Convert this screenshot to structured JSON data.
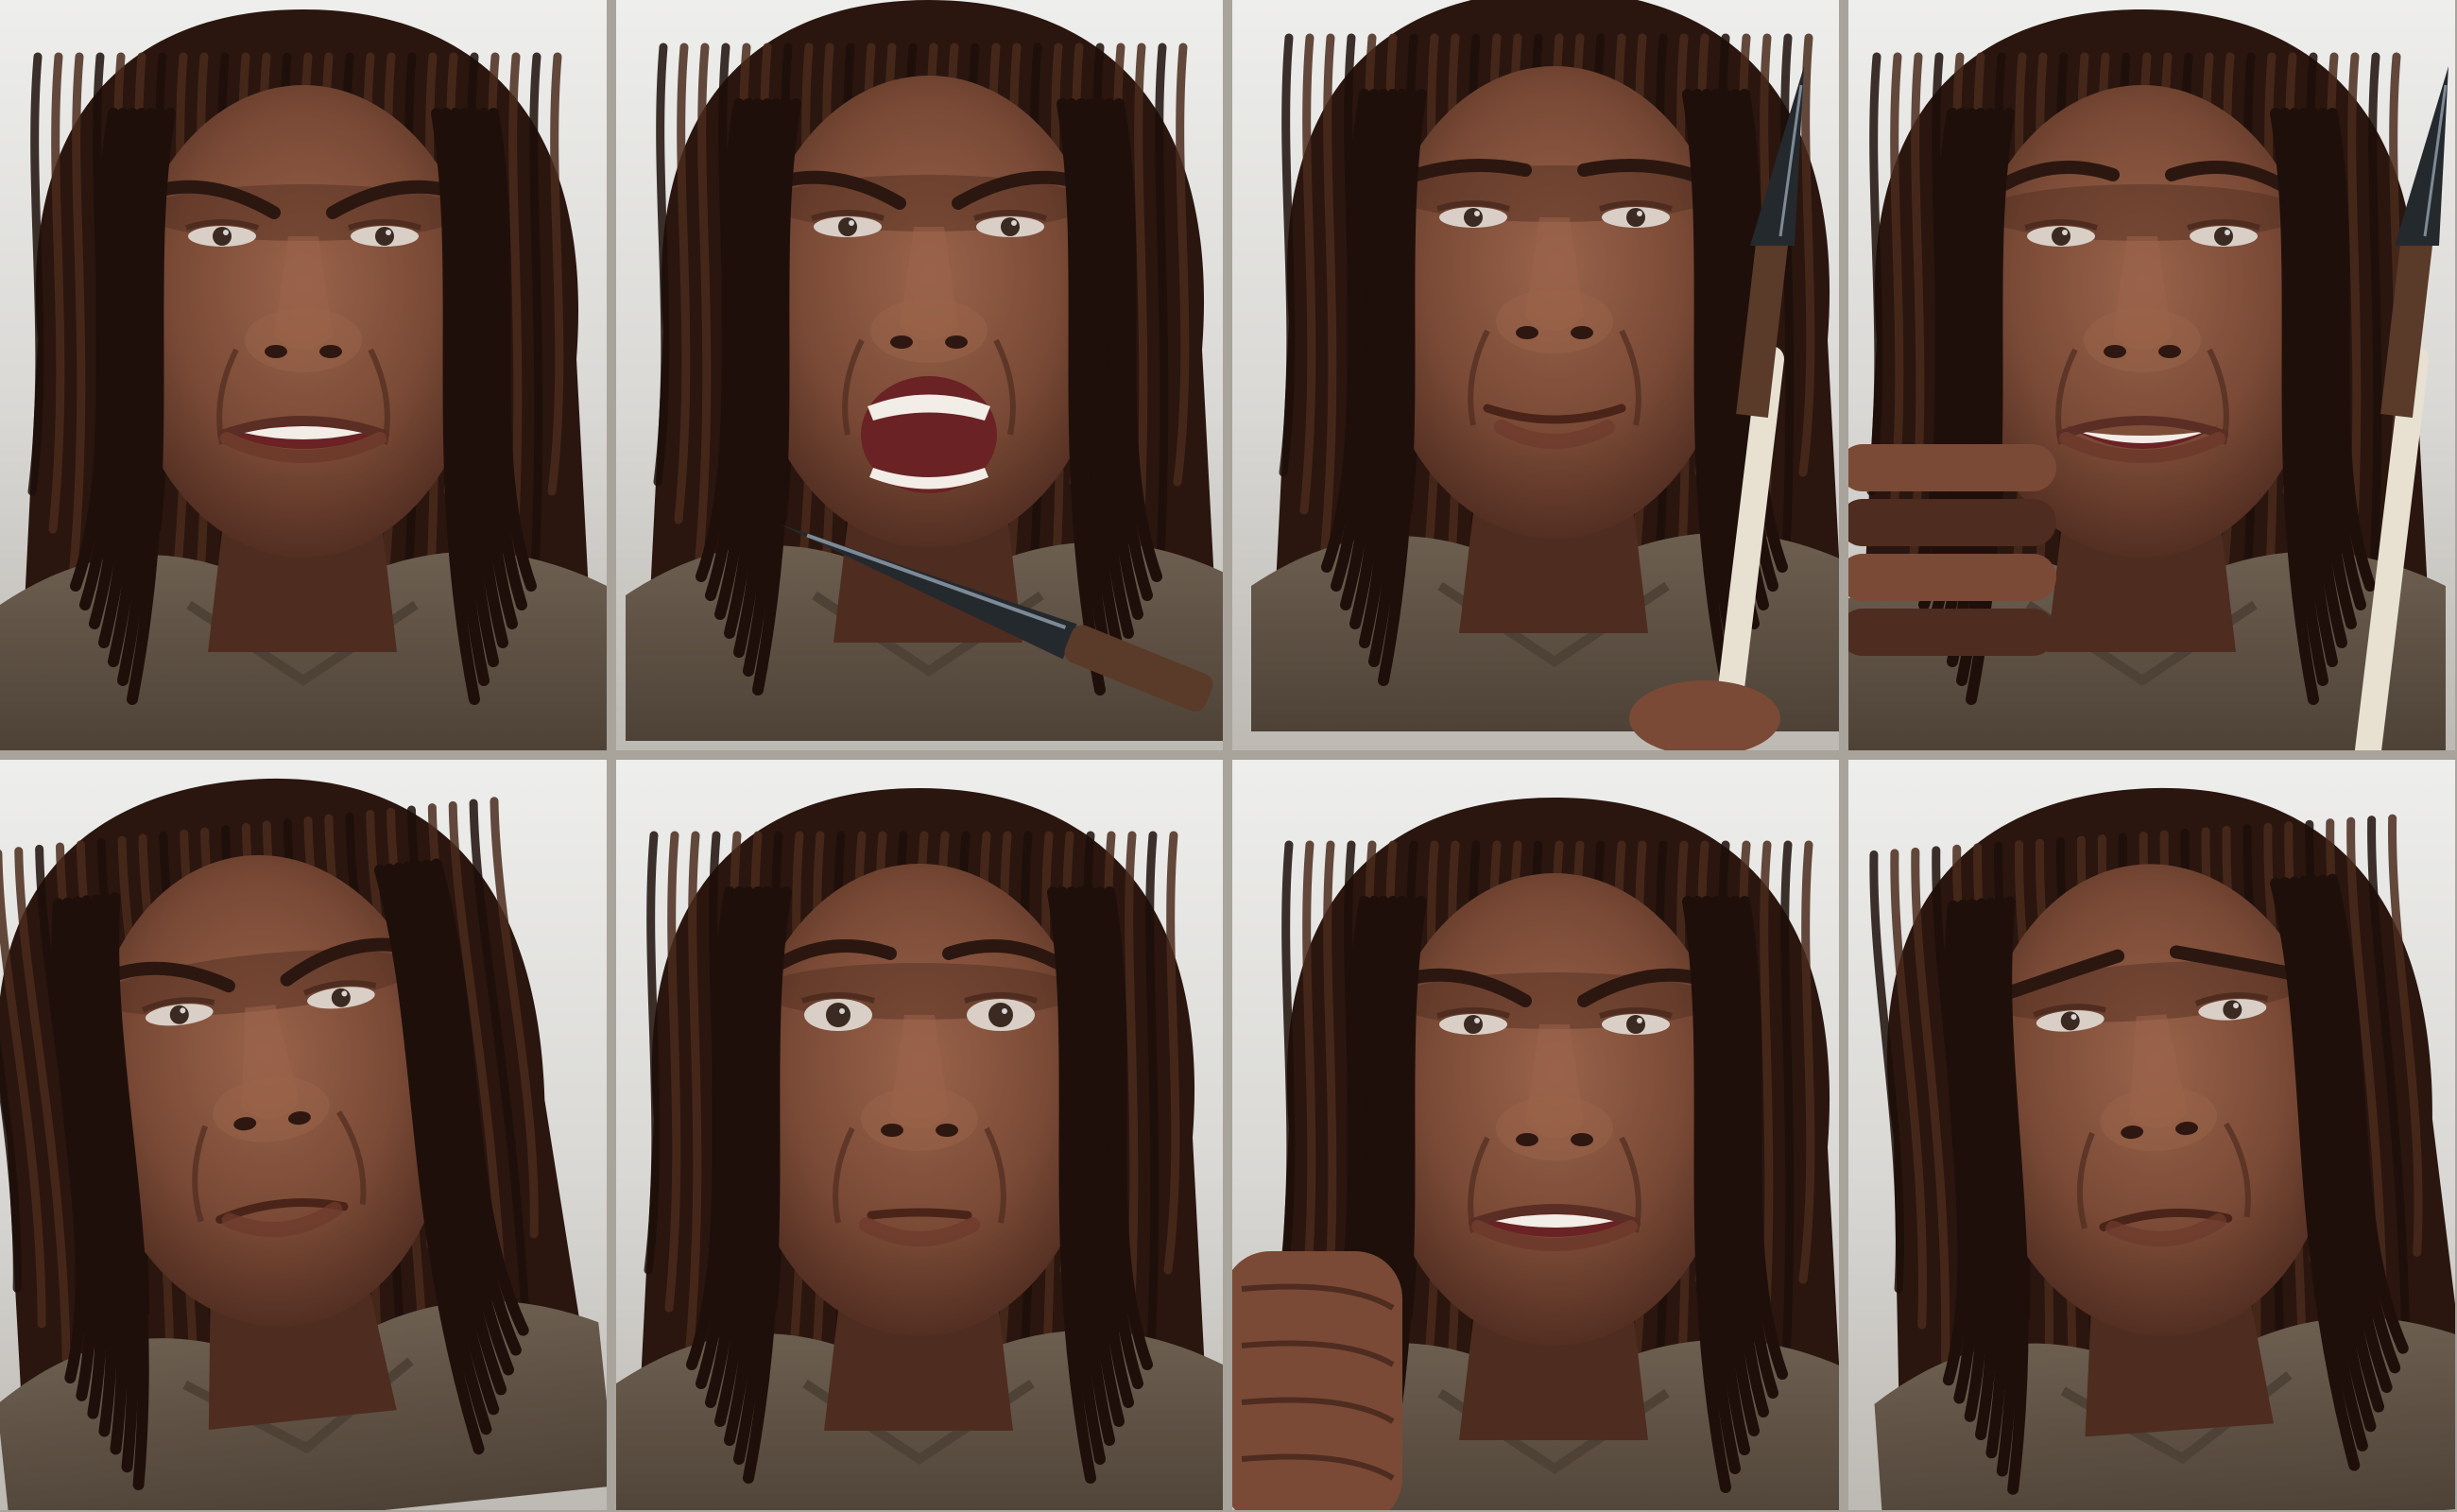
{
  "palette": {
    "backdrop": "#ecebe8",
    "hair": "#2a160f",
    "hair_highlight": "#4a2a1c",
    "skin": "#7a4a36",
    "skin_shadow": "#4f2c20",
    "skin_highlight": "#9a634a",
    "hide_clothing": "#6d5f50",
    "hide_shadow": "#4e4237",
    "teeth": "#f2ede6",
    "mouth_inner": "#6a2224",
    "eye_white": "#d9cfc6",
    "iris": "#3a2a22",
    "blade": "#24292e",
    "blade_highlight": "#7d8a95",
    "spear_shaft": "#e8e1d2",
    "binding": "#5a3a28"
  },
  "panels": [
    {
      "expression": "disgust",
      "mouth": "teeth-grimace",
      "brows": "furrowed",
      "prop": "none"
    },
    {
      "expression": "rage",
      "mouth": "open-shout",
      "brows": "furrowed",
      "prop": "knife"
    },
    {
      "expression": "content",
      "mouth": "closed-smile",
      "brows": "neutral",
      "prop": "spear"
    },
    {
      "expression": "grin",
      "mouth": "teeth-smile",
      "brows": "raised",
      "prop": "spear-and-hand"
    },
    {
      "expression": "suspicious",
      "mouth": "closed-frown",
      "brows": "furrowed",
      "prop": "none"
    },
    {
      "expression": "alarmed",
      "mouth": "closed-pursed",
      "brows": "raised",
      "prop": "none"
    },
    {
      "expression": "anguish",
      "mouth": "teeth-grimace",
      "brows": "furrowed",
      "prop": "fist"
    },
    {
      "expression": "sadness",
      "mouth": "closed-frown",
      "brows": "sad",
      "prop": "none"
    }
  ]
}
